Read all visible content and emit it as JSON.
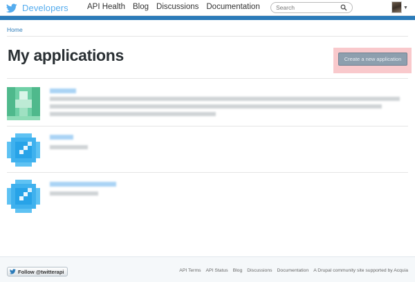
{
  "header": {
    "brand_label": "Developers",
    "nav": [
      "API Health",
      "Blog",
      "Discussions",
      "Documentation"
    ],
    "search_placeholder": "Search"
  },
  "breadcrumb": {
    "home": "Home"
  },
  "main": {
    "title": "My applications",
    "create_button": "Create a new application"
  },
  "apps": [
    {
      "icon": "green-app-icon",
      "name": "",
      "description": ""
    },
    {
      "icon": "blue-check-app-icon",
      "name": "",
      "description": ""
    },
    {
      "icon": "blue-check-app-icon",
      "name": "",
      "description": ""
    }
  ],
  "footer": {
    "follow_label": "Follow @twitterapi",
    "links": [
      "API Terms",
      "API Status",
      "Blog",
      "Discussions",
      "Documentation",
      "A Drupal community site supported by Acquia"
    ]
  },
  "colors": {
    "brand_blue": "#55acee",
    "accent_strip": "#2b7bb9",
    "create_button": "#8d9fae",
    "create_highlight": "#f9c9cc"
  }
}
